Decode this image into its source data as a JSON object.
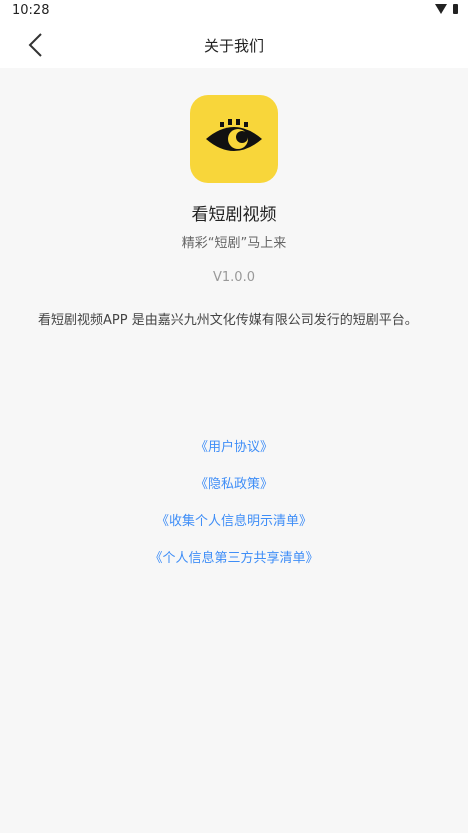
{
  "status_bar": {
    "time": "10:28"
  },
  "header": {
    "title": "关于我们",
    "back_icon": "chevron-left-icon"
  },
  "app": {
    "icon": "eye-logo-icon",
    "icon_bg_color": "#f8d63a",
    "name": "看短剧视频",
    "slogan": "精彩“短剧”马上来",
    "version": "V1.0.0",
    "description": "看短剧视频APP 是由嘉兴九州文化传媒有限公司发行的短剧平台。"
  },
  "links": [
    {
      "label": "《用户协议》"
    },
    {
      "label": "《隐私政策》"
    },
    {
      "label": "《收集个人信息明示清单》"
    },
    {
      "label": "《个人信息第三方共享清单》"
    }
  ],
  "colors": {
    "link": "#3f8ef7",
    "background": "#f7f7f7"
  }
}
